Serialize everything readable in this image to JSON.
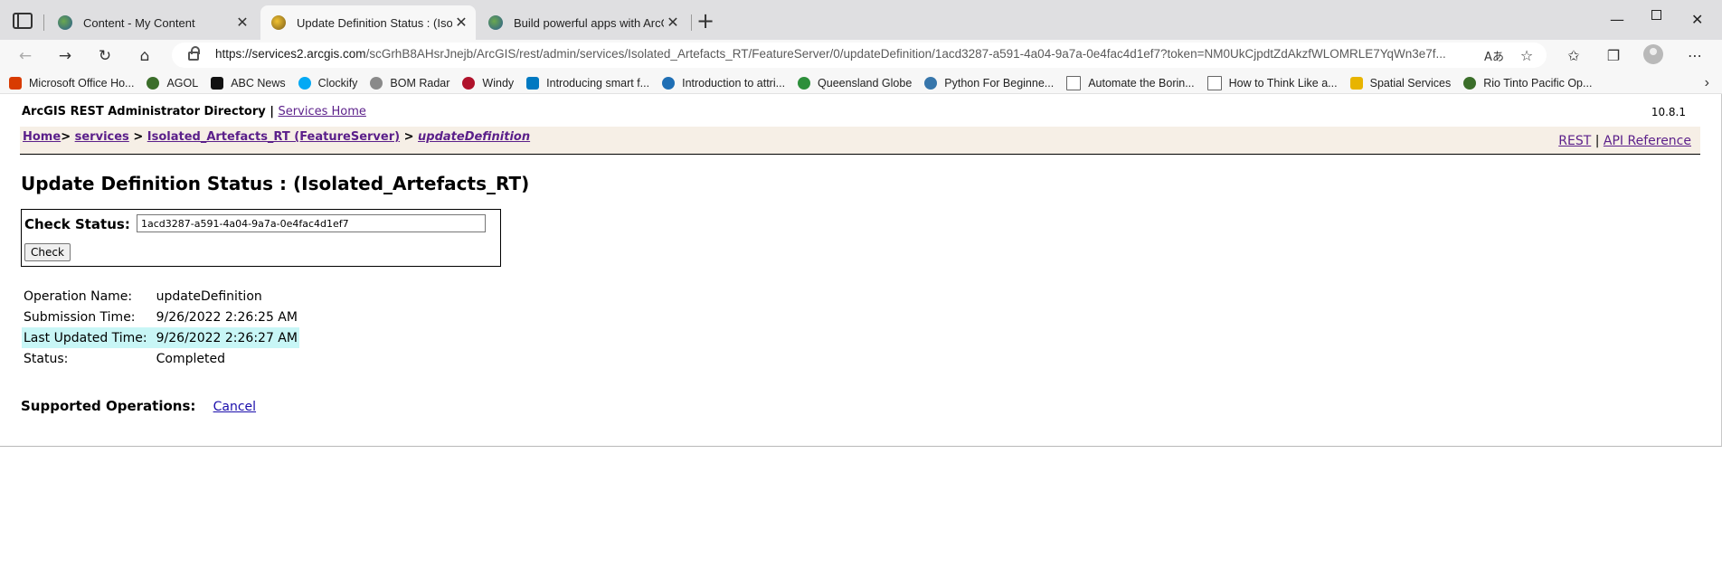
{
  "browser": {
    "tabs": [
      {
        "title": "Content - My Content",
        "active": false
      },
      {
        "title": "Update Definition Status : (Isolat",
        "active": true
      },
      {
        "title": "Build powerful apps with ArcGIS",
        "active": false
      }
    ],
    "url_host": "https://services2.arcgis.com",
    "url_path": "/scGrhB8AHsrJnejb/ArcGIS/rest/admin/services/Isolated_Artefacts_RT/FeatureServer/0/updateDefinition/1acd3287-a591-4a04-9a7a-0e4fac4d1ef7?token=NM0UkCjpdtZdAkzfWLOMRLE7YqWn3e7f...",
    "favorites": [
      {
        "label": "Microsoft Office Ho...",
        "icon": "office-icon",
        "color": "#d83b01"
      },
      {
        "label": "AGOL",
        "icon": "globe-icon",
        "color": "#3b6e2a"
      },
      {
        "label": "ABC News",
        "icon": "abc-icon",
        "color": "#111111"
      },
      {
        "label": "Clockify",
        "icon": "clockify-icon",
        "color": "#03a9f4"
      },
      {
        "label": "BOM Radar",
        "icon": "bom-icon",
        "color": "#8a8a8a"
      },
      {
        "label": "Windy",
        "icon": "windy-icon",
        "color": "#b0122b"
      },
      {
        "label": "Introducing smart f...",
        "icon": "esri-icon",
        "color": "#0079c1"
      },
      {
        "label": "Introduction to attri...",
        "icon": "arcgis-icon",
        "color": "#1f6fb5"
      },
      {
        "label": "Queensland Globe",
        "icon": "search-globe-icon",
        "color": "#2d8f3b"
      },
      {
        "label": "Python For Beginne...",
        "icon": "python-icon",
        "color": "#3776ab"
      },
      {
        "label": "Automate the Borin...",
        "icon": "page-icon",
        "color": "#666666"
      },
      {
        "label": "How to Think Like a...",
        "icon": "page-icon",
        "color": "#666666"
      },
      {
        "label": "Spatial Services",
        "icon": "folder-icon",
        "color": "#e8b400"
      },
      {
        "label": "Rio Tinto Pacific Op...",
        "icon": "globe-icon",
        "color": "#3b6e2a"
      }
    ]
  },
  "header": {
    "directory": "ArcGIS REST Administrator Directory",
    "separator": "|",
    "services_home": "Services Home",
    "version": "10.8.1"
  },
  "breadcrumb": {
    "home": "Home",
    "services": "services",
    "service": "Isolated_Artefacts_RT (FeatureServer)",
    "current": "updateDefinition",
    "sep1": ">",
    "sep2": ">",
    "sep3": ">",
    "rest": "REST",
    "pipe": "|",
    "api_reference": "API Reference"
  },
  "page_title": "Update Definition Status : (Isolated_Artefacts_RT)",
  "check": {
    "label": "Check Status:",
    "value": "1acd3287-a591-4a04-9a7a-0e4fac4d1ef7",
    "button": "Check"
  },
  "details": [
    {
      "label": "Operation Name:",
      "value": "updateDefinition"
    },
    {
      "label": "Submission Time:",
      "value": "9/26/2022 2:26:25 AM"
    },
    {
      "label": "Last Updated Time:",
      "value": "9/26/2022 2:26:27 AM"
    },
    {
      "label": "Status:",
      "value": "Completed"
    }
  ],
  "supported_operations": {
    "label": "Supported Operations:",
    "cancel": "Cancel"
  }
}
